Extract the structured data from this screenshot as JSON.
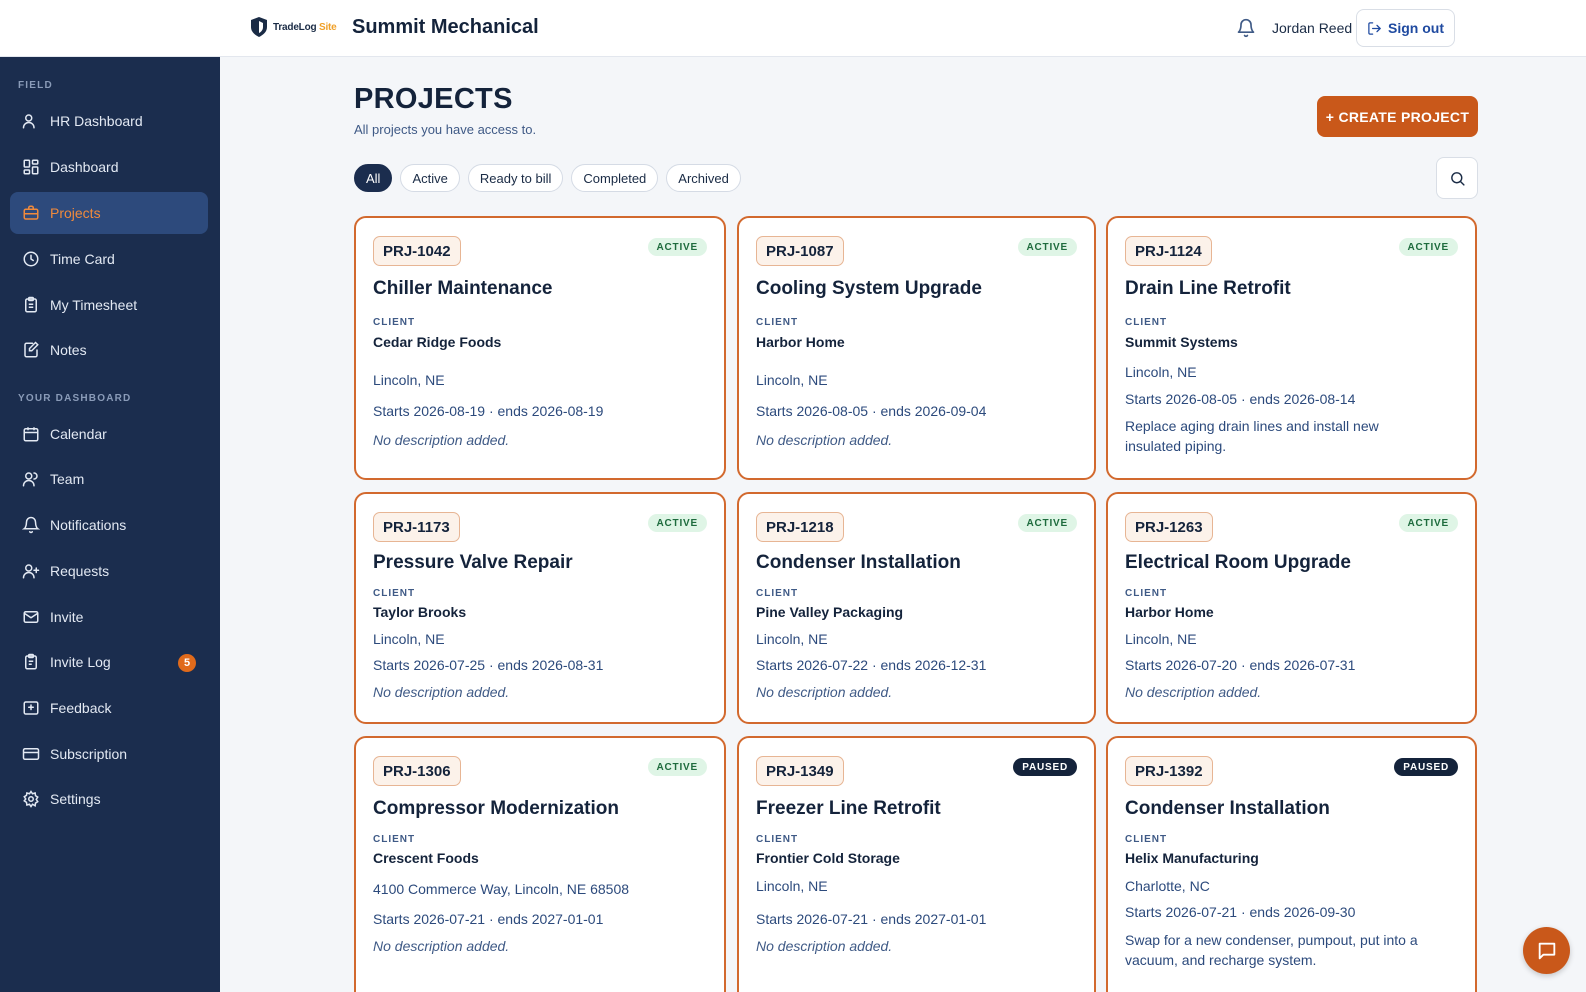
{
  "header": {
    "logo": {
      "brand": "TradeLog",
      "suffix": "Site"
    },
    "company": "Summit Mechanical",
    "user": "Jordan Reed",
    "signout": "Sign out"
  },
  "sidebar": {
    "field_label": "FIELD",
    "dashboard_label": "YOUR DASHBOARD",
    "items": [
      {
        "label": "HR Dashboard",
        "icon": "users-icon"
      },
      {
        "label": "Dashboard",
        "icon": "grid-icon"
      },
      {
        "label": "Projects",
        "icon": "briefcase-icon",
        "active": true
      },
      {
        "label": "Time Card",
        "icon": "clock-icon"
      },
      {
        "label": "My Timesheet",
        "icon": "clipboard-icon"
      },
      {
        "label": "Notes",
        "icon": "note-icon"
      },
      {
        "label": "Calendar",
        "icon": "calendar-icon"
      },
      {
        "label": "Team",
        "icon": "team-icon"
      },
      {
        "label": "Notifications",
        "icon": "bell-icon"
      },
      {
        "label": "Requests",
        "icon": "user-plus-icon"
      },
      {
        "label": "Invite",
        "icon": "mail-icon"
      },
      {
        "label": "Invite Log",
        "icon": "log-icon",
        "badge": "5"
      },
      {
        "label": "Feedback",
        "icon": "feedback-icon"
      },
      {
        "label": "Subscription",
        "icon": "card-icon"
      },
      {
        "label": "Settings",
        "icon": "gear-icon"
      }
    ]
  },
  "main": {
    "title": "PROJECTS",
    "subtitle": "All projects you have access to.",
    "create_label": "+ CREATE PROJECT",
    "filters": [
      "All",
      "Active",
      "Ready to bill",
      "Completed",
      "Archived"
    ],
    "active_filter": "All",
    "client_label": "CLIENT",
    "projects": [
      {
        "code": "PRJ-1042",
        "status": "ACTIVE",
        "name": "Chiller Maintenance",
        "client": "Cedar Ridge Foods",
        "location": "Lincoln, NE",
        "dates": "Starts 2026-08-19 · ends 2026-08-19",
        "description": "No description added."
      },
      {
        "code": "PRJ-1087",
        "status": "ACTIVE",
        "name": "Cooling System Upgrade",
        "client": "Harbor Home",
        "location": "Lincoln, NE",
        "dates": "Starts 2026-08-05 · ends 2026-09-04",
        "description": "No description added."
      },
      {
        "code": "PRJ-1124",
        "status": "ACTIVE",
        "name": "Drain Line Retrofit",
        "client": "Summit Systems",
        "location": "Lincoln, NE",
        "dates": "Starts 2026-08-05 · ends 2026-08-14",
        "description": "Replace aging drain lines and install new insulated piping."
      },
      {
        "code": "PRJ-1173",
        "status": "ACTIVE",
        "name": "Pressure Valve Repair",
        "client": "Taylor Brooks",
        "location": "Lincoln, NE",
        "dates": "Starts 2026-07-25 · ends 2026-08-31",
        "description": "No description added."
      },
      {
        "code": "PRJ-1218",
        "status": "ACTIVE",
        "name": "Condenser Installation",
        "client": "Pine Valley Packaging",
        "location": "Lincoln, NE",
        "dates": "Starts 2026-07-22 · ends 2026-12-31",
        "description": "No description added."
      },
      {
        "code": "PRJ-1263",
        "status": "ACTIVE",
        "name": "Electrical Room Upgrade",
        "client": "Harbor Home",
        "location": "Lincoln, NE",
        "dates": "Starts 2026-07-20 · ends 2026-07-31",
        "description": "No description added."
      },
      {
        "code": "PRJ-1306",
        "status": "ACTIVE",
        "name": "Compressor Modernization",
        "client": "Crescent Foods",
        "location": "4100 Commerce Way, Lincoln, NE 68508",
        "dates": "Starts 2026-07-21 · ends 2027-01-01",
        "description": "No description added."
      },
      {
        "code": "PRJ-1349",
        "status": "PAUSED",
        "name": "Freezer Line Retrofit",
        "client": "Frontier Cold Storage",
        "location": "Lincoln, NE",
        "dates": "Starts 2026-07-21 · ends 2027-01-01",
        "description": "No description added."
      },
      {
        "code": "PRJ-1392",
        "status": "PAUSED",
        "name": "Condenser Installation",
        "client": "Helix Manufacturing",
        "location": "Charlotte, NC",
        "dates": "Starts 2026-07-21 · ends 2026-09-30",
        "description": "Swap for a new condenser, pumpout, put into a vacuum, and recharge system."
      }
    ]
  },
  "colors": {
    "accent": "#c9581a",
    "sidebar": "#1b2d4e",
    "active_status": "#dff5e6",
    "paused_status": "#14233b"
  }
}
